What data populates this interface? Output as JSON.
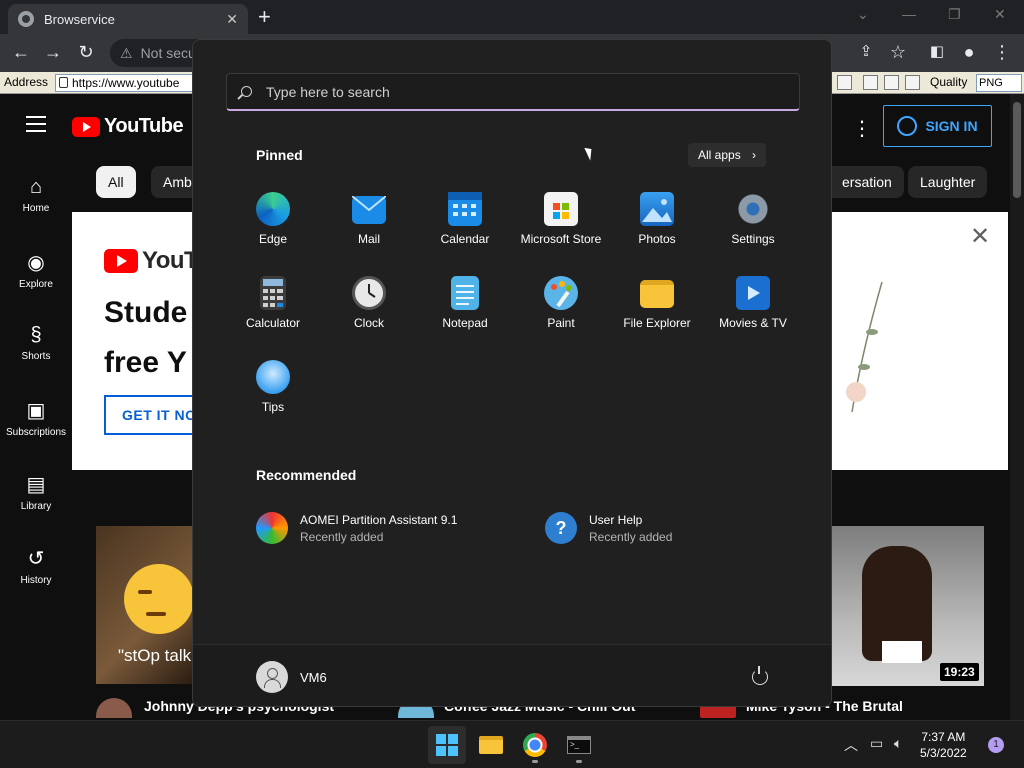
{
  "browser": {
    "tab_title": "Browservice",
    "tab_close": "✕",
    "new_tab": "+",
    "address_partial": "Not secu",
    "window_min": "—",
    "window_max": "❐",
    "window_close": "✕"
  },
  "xp_bar": {
    "address_label": "Address",
    "address_value": "https://www.youtube",
    "quality_label": "Quality",
    "quality_value": "PNG"
  },
  "youtube": {
    "logo_text": "YouTube",
    "sign_in": "SIGN IN",
    "nav": [
      {
        "label": "Home",
        "icon": "home-icon",
        "glyph": "⌂"
      },
      {
        "label": "Explore",
        "icon": "compass-icon",
        "glyph": "◉"
      },
      {
        "label": "Shorts",
        "icon": "shorts-icon",
        "glyph": "§"
      },
      {
        "label": "Subscriptions",
        "icon": "subscriptions-icon",
        "glyph": "▣"
      },
      {
        "label": "Library",
        "icon": "library-icon",
        "glyph": "▤"
      },
      {
        "label": "History",
        "icon": "history-icon",
        "glyph": "↺"
      }
    ],
    "chips": [
      "All",
      "Amb",
      "ersation",
      "Laughter"
    ],
    "banner": {
      "logo_text": "YouTub",
      "title_line1": "Stude",
      "title_line2": "free Y",
      "button": "GET IT NO",
      "close": "✕"
    },
    "video_caption": "\"stOp talki",
    "duration": "19:23",
    "video_titles": [
      "Johnny Depp's psychologist",
      "Coffee Jazz Music - Chill Out",
      "Mike Tyson - The Brutal"
    ]
  },
  "start_menu": {
    "search_placeholder": "Type here to search",
    "pinned_title": "Pinned",
    "all_apps": "All apps",
    "pinned": [
      {
        "label": "Edge",
        "icon": "edge-icon"
      },
      {
        "label": "Mail",
        "icon": "mail-icon"
      },
      {
        "label": "Calendar",
        "icon": "calendar-icon"
      },
      {
        "label": "Microsoft Store",
        "icon": "store-icon"
      },
      {
        "label": "Photos",
        "icon": "photos-icon"
      },
      {
        "label": "Settings",
        "icon": "settings-icon"
      },
      {
        "label": "Calculator",
        "icon": "calculator-icon"
      },
      {
        "label": "Clock",
        "icon": "clock-icon"
      },
      {
        "label": "Notepad",
        "icon": "notepad-icon"
      },
      {
        "label": "Paint",
        "icon": "paint-icon"
      },
      {
        "label": "File Explorer",
        "icon": "folder-icon"
      },
      {
        "label": "Movies & TV",
        "icon": "movies-icon"
      },
      {
        "label": "Tips",
        "icon": "tips-icon"
      }
    ],
    "recommended_title": "Recommended",
    "recommended": [
      {
        "name": "AOMEI Partition Assistant 9.1",
        "sub": "Recently added",
        "icon": "aomei-icon"
      },
      {
        "name": "User Help",
        "sub": "Recently added",
        "icon": "help-icon"
      }
    ],
    "user_name": "VM6"
  },
  "taskbar": {
    "time": "7:37 AM",
    "date": "5/3/2022",
    "notification_count": "1",
    "apps": [
      "start-icon",
      "file-explorer-icon",
      "chrome-icon",
      "terminal-icon"
    ]
  },
  "colors": {
    "accent": "#4cc2ff",
    "youtube_red": "#ff0000",
    "signin_blue": "#3ea6ff"
  }
}
